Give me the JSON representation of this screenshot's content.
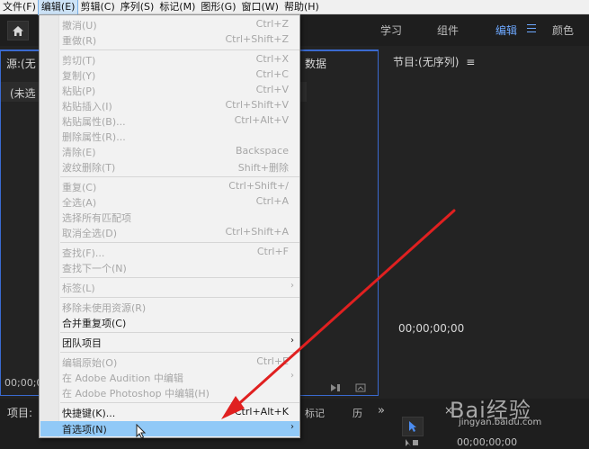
{
  "menubar": {
    "items": [
      "文件(F)",
      "编辑(E)",
      "剪辑(C)",
      "序列(S)",
      "标记(M)",
      "图形(G)",
      "窗口(W)",
      "帮助(H)"
    ]
  },
  "workspaces": {
    "tabs": [
      "学习",
      "组件",
      "编辑",
      "颜色"
    ],
    "active": "编辑"
  },
  "source_panel": {
    "title": "源:(无",
    "title_suffix": "数据",
    "sub": "(未选",
    "timecode": "00;00;0"
  },
  "program_panel": {
    "title": "节目:(无序列)",
    "timecode": "00;00;00;00"
  },
  "bottom": {
    "project_label": "项目:",
    "markers_label": "标记",
    "tab_marker": "历",
    "close_symbol": "×",
    "timeline_time": "00;00;00;00"
  },
  "edit_menu": {
    "items": [
      {
        "label": "撤消(U)",
        "shortcut": "Ctrl+Z",
        "enabled": false
      },
      {
        "label": "重做(R)",
        "shortcut": "Ctrl+Shift+Z",
        "enabled": false
      },
      {
        "label": "剪切(T)",
        "shortcut": "Ctrl+X",
        "enabled": false
      },
      {
        "label": "复制(Y)",
        "shortcut": "Ctrl+C",
        "enabled": false
      },
      {
        "label": "粘贴(P)",
        "shortcut": "Ctrl+V",
        "enabled": false
      },
      {
        "label": "粘贴插入(I)",
        "shortcut": "Ctrl+Shift+V",
        "enabled": false
      },
      {
        "label": "粘贴属性(B)...",
        "shortcut": "Ctrl+Alt+V",
        "enabled": false
      },
      {
        "label": "删除属性(R)...",
        "shortcut": "",
        "enabled": false
      },
      {
        "label": "清除(E)",
        "shortcut": "Backspace",
        "enabled": false
      },
      {
        "label": "波纹删除(T)",
        "shortcut": "Shift+删除",
        "enabled": false
      },
      {
        "label": "重复(C)",
        "shortcut": "Ctrl+Shift+/",
        "enabled": false
      },
      {
        "label": "全选(A)",
        "shortcut": "Ctrl+A",
        "enabled": false
      },
      {
        "label": "选择所有匹配项",
        "shortcut": "",
        "enabled": false
      },
      {
        "label": "取消全选(D)",
        "shortcut": "Ctrl+Shift+A",
        "enabled": false
      },
      {
        "label": "查找(F)...",
        "shortcut": "Ctrl+F",
        "enabled": false
      },
      {
        "label": "查找下一个(N)",
        "shortcut": "",
        "enabled": false
      },
      {
        "label": "标签(L)",
        "shortcut": "",
        "enabled": false,
        "submenu": true
      },
      {
        "label": "移除未使用资源(R)",
        "shortcut": "",
        "enabled": false
      },
      {
        "label": "合并重复项(C)",
        "shortcut": "",
        "enabled": true
      },
      {
        "label": "团队项目",
        "shortcut": "",
        "enabled": true,
        "submenu": true
      },
      {
        "label": "编辑原始(O)",
        "shortcut": "Ctrl+E",
        "enabled": false
      },
      {
        "label": "在 Adobe Audition 中编辑",
        "shortcut": "",
        "enabled": false,
        "submenu": true
      },
      {
        "label": "在 Adobe Photoshop 中编辑(H)",
        "shortcut": "",
        "enabled": false
      },
      {
        "label": "快捷键(K)...",
        "shortcut": "Ctrl+Alt+K",
        "enabled": true
      },
      {
        "label": "首选项(N)",
        "shortcut": "",
        "enabled": true,
        "submenu": true,
        "highlighted": true
      }
    ],
    "submenu_arrow": "›"
  },
  "watermark": {
    "big": "Bai经验",
    "small": "jingyan.baidu.com"
  },
  "colors": {
    "accent_blue": "#6da8ff",
    "annotation_red": "#e02020",
    "menu_highlight": "#91c9f7"
  }
}
